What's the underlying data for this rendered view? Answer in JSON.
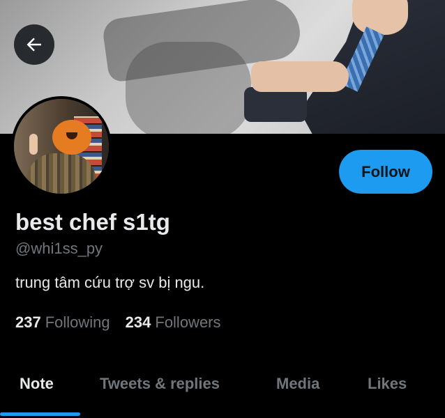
{
  "header": {
    "back_icon": "arrow-left-icon"
  },
  "profile": {
    "name": "best chef s1tg",
    "handle": "@whi1ss_py",
    "bio": "trung tâm cứu trợ sv bị ngu.",
    "follow_label": "Follow"
  },
  "stats": {
    "following_count": "237",
    "following_label": "Following",
    "followers_count": "234",
    "followers_label": "Followers"
  },
  "tabs": [
    {
      "label": "Note",
      "active": true
    },
    {
      "label": "Tweets & replies",
      "active": false
    },
    {
      "label": "Media",
      "active": false
    },
    {
      "label": "Likes",
      "active": false
    }
  ],
  "colors": {
    "accent": "#1d9bf0",
    "background": "#000000",
    "primary_text": "#e7e9ea",
    "secondary_text": "#71767b"
  }
}
